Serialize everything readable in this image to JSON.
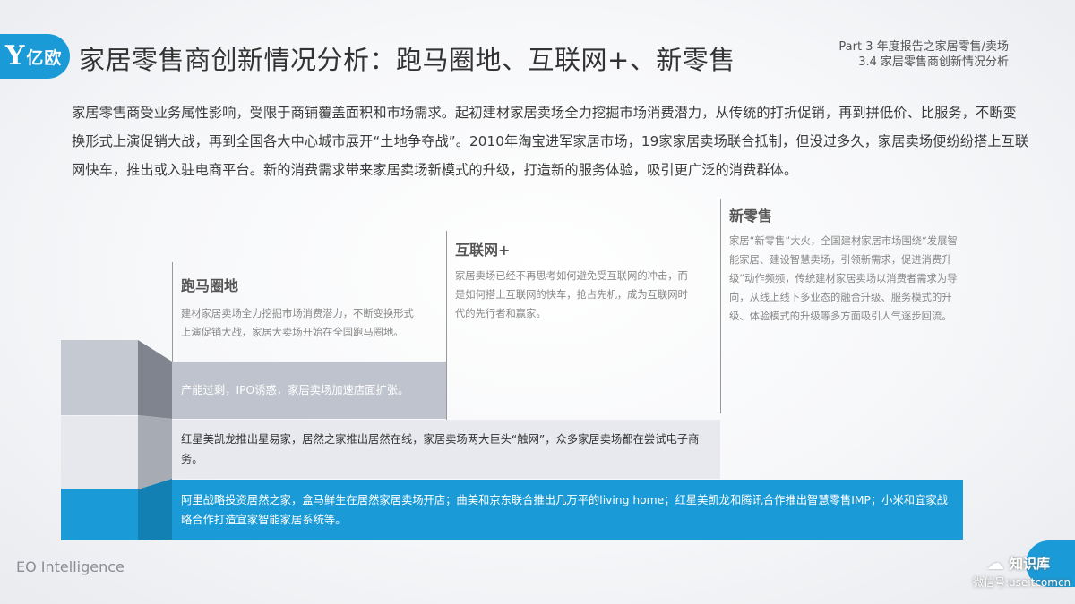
{
  "header": {
    "logo_mark": "Y",
    "logo_text": "亿欧",
    "title": "家居零售商创新情况分析：跑马圈地、互联网+、新零售",
    "section_line1": "Part 3 年度报告之家居零售/卖场",
    "section_line2": "3.4 家居零售商创新情况分析"
  },
  "intro": "家居零售商受业务属性影响，受限于商铺覆盖面积和市场需求。起初建材家居卖场全力挖掘市场消费潜力，从传统的打折促销，再到拼低价、比服务，不断变换形式上演促销大战，再到全国各大中心城市展开“土地争夺战”。2010年淘宝进军家居市场，19家家居卖场联合抵制，但没过多久，家居卖场便纷纷搭上互联网快车，推出或入驻电商平台。新的消费需求带来家居卖场新模式的升级，打造新的服务体验，吸引更广泛的消费群体。",
  "stages": [
    {
      "title": "跑马圈地",
      "desc": "建材家居卖场全力挖掘市场消费潜力，不断变换形式上演促销大战，家居大卖场开始在全国跑马圈地。",
      "band": "产能过剩，IPO诱惑，家居卖场加速店面扩张。"
    },
    {
      "title": "互联网+",
      "desc": "家居卖场已经不再思考如何避免受互联网的冲击，而是如何搭上互联网的快车，抢占先机，成为互联网时代的先行者和赢家。",
      "band": "红星美凯龙推出星易家，居然之家推出居然在线，家居卖场两大巨头“触网”，众多家居卖场都在尝试电子商务。"
    },
    {
      "title": "新零售",
      "desc": "家居“新零售”大火，全国建材家居市场围绕“发展智能家居、建设智慧卖场，引领新需求，促进消费升级”动作频频，传统建材家居卖场以消费者需求为导向，从线上线下多业态的融合升级、服务模式的升级、体验模式的升级等多方面吸引人气逐步回流。",
      "band": "阿里战略投资居然之家，盒马鲜生在居然家居卖场开店；曲美和京东联合推出几万平的living home；红星美凯龙和腾讯合作推出智慧零售IMP；小米和宜家战略合作打造宜家智能家居系统等。"
    }
  ],
  "footer": {
    "brand": "EO Intelligence",
    "wechat_name": "知识库",
    "wechat_id": "微信号:useitcomcn"
  }
}
